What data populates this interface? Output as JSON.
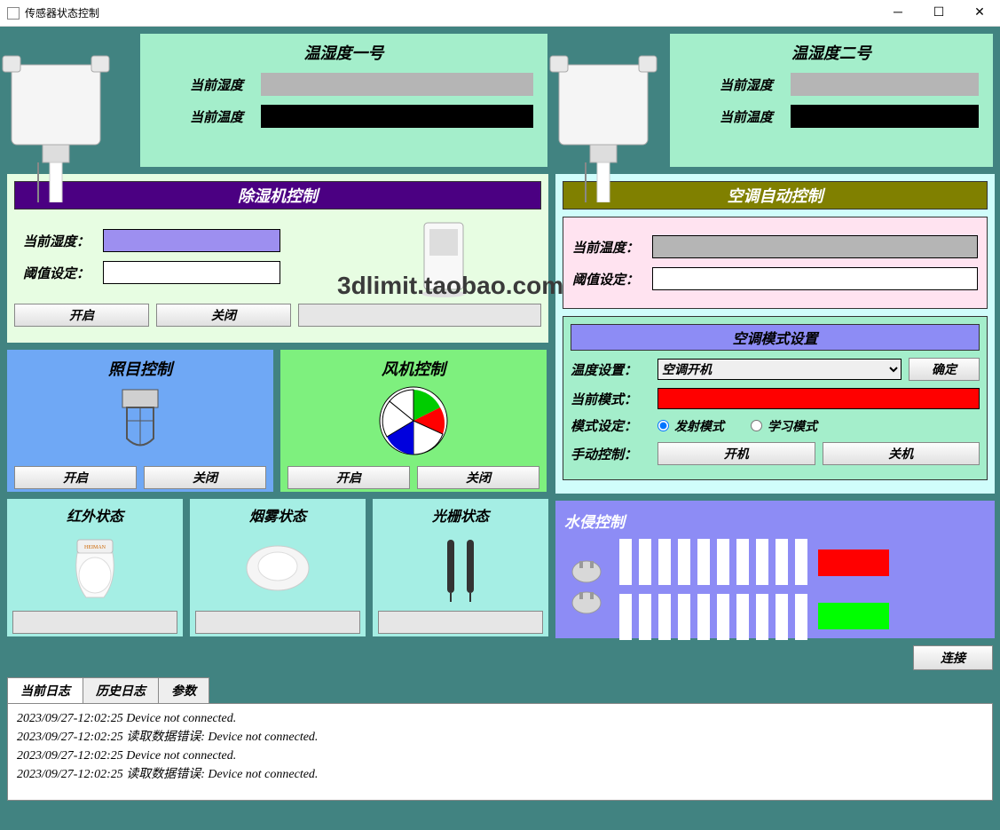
{
  "window": {
    "title": "传感器状态控制"
  },
  "th1": {
    "title": "温湿度一号",
    "humidity_label": "当前湿度",
    "temp_label": "当前温度"
  },
  "th2": {
    "title": "温湿度二号",
    "humidity_label": "当前湿度",
    "temp_label": "当前温度"
  },
  "dehum": {
    "title": "除湿机控制",
    "humidity_label": "当前湿度：",
    "threshold_label": "阈值设定：",
    "open_btn": "开启",
    "close_btn": "关闭"
  },
  "ac": {
    "title": "空调自动控制",
    "temp_label": "当前温度：",
    "threshold_label": "阈值设定："
  },
  "ac_mode": {
    "title": "空调模式设置",
    "temp_set_label": "温度设置：",
    "selected": "空调开机",
    "confirm_btn": "确定",
    "cur_mode_label": "当前模式：",
    "mode_set_label": "模式设定：",
    "radio1": "发射模式",
    "radio2": "学习模式",
    "manual_label": "手动控制：",
    "on_btn": "开机",
    "off_btn": "关机"
  },
  "light": {
    "title": "照目控制",
    "open_btn": "开启",
    "close_btn": "关闭"
  },
  "fan": {
    "title": "风机控制",
    "open_btn": "开启",
    "close_btn": "关闭"
  },
  "ir": {
    "title": "红外状态"
  },
  "smoke": {
    "title": "烟雾状态"
  },
  "grating": {
    "title": "光栅状态"
  },
  "water": {
    "title": "水侵控制"
  },
  "connect_btn": "连接",
  "tabs": {
    "current": "当前日志",
    "history": "历史日志",
    "params": "参数"
  },
  "logs": [
    "2023/09/27-12:02:25 Device not connected.",
    "2023/09/27-12:02:25 读取数据错误: Device not connected.",
    "2023/09/27-12:02:25 Device not connected.",
    "2023/09/27-12:02:25 读取数据错误: Device not connected."
  ],
  "watermark": "3dlimit.taobao.com"
}
